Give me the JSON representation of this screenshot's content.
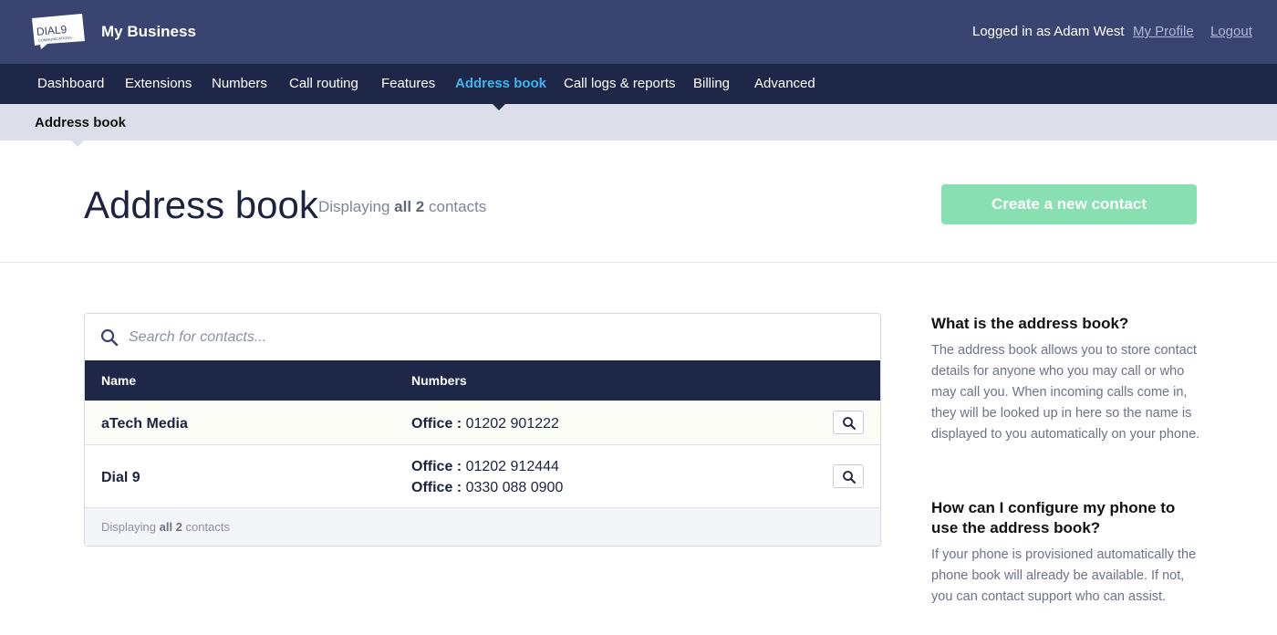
{
  "header": {
    "logo": {
      "line1": "DIAL9",
      "line2": "COMMUNICATIONS"
    },
    "title": "My Business",
    "logged_in_text": "Logged in as Adam West",
    "links": [
      "My Profile",
      "Logout"
    ]
  },
  "nav": {
    "items": [
      "Dashboard",
      "Extensions",
      "Numbers",
      "Call routing",
      "Features",
      "Address book",
      "Call logs & reports",
      "Billing",
      "Advanced"
    ],
    "active": "Address book"
  },
  "subnav": {
    "title": "Address book"
  },
  "page": {
    "title": "Address book",
    "count_prefix": "Displaying",
    "count_bold": "all 2",
    "count_suffix": "contacts",
    "create_button": "Create a new contact"
  },
  "search": {
    "placeholder": "Search for contacts..."
  },
  "table": {
    "columns": [
      "Name",
      "Numbers"
    ],
    "rows": [
      {
        "name": "aTech Media",
        "numbers": [
          {
            "label": "Office :",
            "number": "01202 901222"
          }
        ]
      },
      {
        "name": "Dial 9",
        "numbers": [
          {
            "label": "Office :",
            "number": "01202 912444"
          },
          {
            "label": "Office :",
            "number": "0330 088 0900"
          }
        ]
      }
    ],
    "footer_prefix": "Displaying",
    "footer_bold": "all 2",
    "footer_suffix": "contacts"
  },
  "sidebar": {
    "sections": [
      {
        "heading": "What is the address book?",
        "body": "The address book allows you to store contact details for anyone who you may call or who may call you. When incoming calls come in, they will be looked up in here so the name is displayed to you automatically on your phone."
      },
      {
        "heading": "How can I configure my phone to use the address book?",
        "body": "If your phone is provisioned automatically the phone book will already be available. If not, you can contact support who can assist."
      }
    ]
  },
  "colors": {
    "topbar": "#3a4470",
    "navbar": "#1f2749",
    "active_nav": "#3fb4ee",
    "create_button": "#88dfb2",
    "subbar": "#dcdfe9"
  },
  "icons": [
    "search-icon",
    "magnifier-icon"
  ]
}
